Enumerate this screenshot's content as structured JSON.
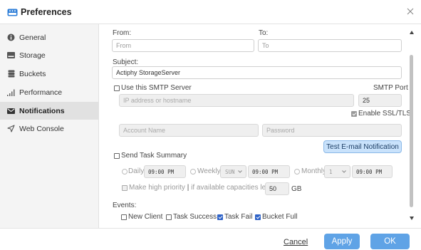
{
  "window": {
    "title": "Preferences"
  },
  "sidebar": {
    "items": [
      {
        "label": "General",
        "icon": "info-icon",
        "active": false
      },
      {
        "label": "Storage",
        "icon": "storage-icon",
        "active": false
      },
      {
        "label": "Buckets",
        "icon": "bucket-icon",
        "active": false
      },
      {
        "label": "Performance",
        "icon": "signal-bars-icon",
        "active": false
      },
      {
        "label": "Notifications",
        "icon": "envelope-icon",
        "active": true
      },
      {
        "label": "Web Console",
        "icon": "web-console-icon",
        "active": false
      }
    ]
  },
  "form": {
    "from_label": "From:",
    "from_placeholder": "From",
    "to_label": "To:",
    "to_placeholder": "To",
    "subject_label": "Subject:",
    "subject_value": "Actiphy StorageServer",
    "smtp_label": "Use this SMTP Server",
    "smtp_checked": false,
    "smtp_port_label": "SMTP Port",
    "smtp_host_placeholder": "IP address or hostname",
    "smtp_port_value": "25",
    "ssl_label": "Enable SSL/TLS",
    "ssl_checked": true,
    "account_placeholder": "Account Name",
    "password_placeholder": "Password",
    "test_button": "Test E-mail Notification",
    "task_summary_label": "Send Task Summary",
    "task_summary_checked": false,
    "daily_label": "Daily",
    "daily_time": "09:00 PM",
    "weekly_label": "Weekly",
    "weekly_day": "SUN",
    "weekly_time": "09:00 PM",
    "monthly_label": "Monthly",
    "monthly_day": "1",
    "monthly_time": "09:00 PM",
    "high_priority_label": "Make high priority",
    "high_priority_tail": "if available capacities less than",
    "high_priority_value": "50",
    "high_priority_unit": "GB",
    "events_label": "Events:",
    "events": [
      {
        "label": "New Client",
        "checked": false
      },
      {
        "label": "Task Success",
        "checked": false
      },
      {
        "label": "Task Fail",
        "checked": true
      },
      {
        "label": "Bucket Full",
        "checked": true
      }
    ]
  },
  "footer": {
    "cancel": "Cancel",
    "apply": "Apply",
    "ok": "OK"
  },
  "colors": {
    "accent": "#5fa3e6",
    "checkbox": "#2f63c8",
    "test_button": "#c9e2fb",
    "sidebar_bg": "#f4f4f4",
    "sidebar_active": "#e1e1e1"
  }
}
